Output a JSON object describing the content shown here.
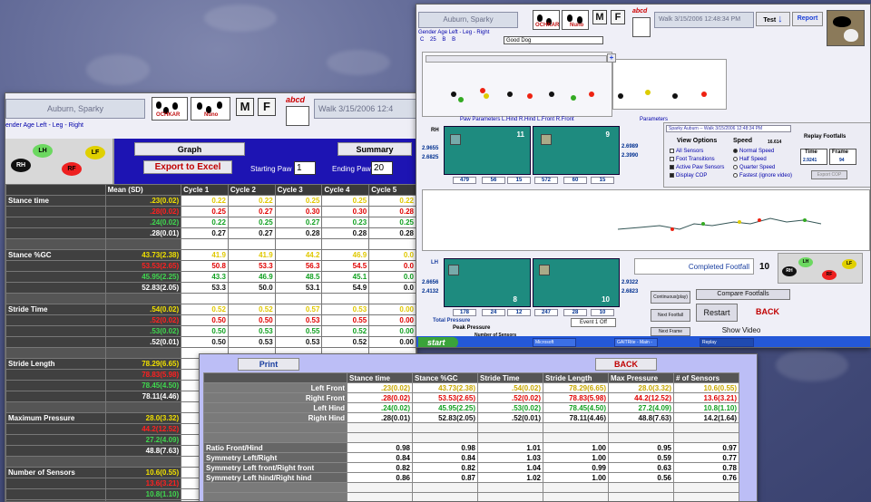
{
  "win1": {
    "dog_name": "Auburn, Sparky",
    "logo_text": "Ochkar Nuno",
    "m_label": "M",
    "f_label": "F",
    "abcd": "abcd",
    "walk": "Walk     3/15/2006 12:4",
    "gender_row": "ender  Age   Left - Leg - Right",
    "paws": {
      "lh": "LH",
      "lf": "LF",
      "rh": "RH",
      "rf": "RF"
    },
    "graph_btn": "Graph",
    "summary_btn": "Summary",
    "export_btn": "Export to Excel",
    "starting_paw_label": "Starting Paw",
    "starting_paw_value": "1",
    "ending_paw_label": "Ending Paw",
    "ending_paw_value": "20",
    "columns": [
      "Mean (SD)",
      "Cycle 1",
      "Cycle 2",
      "Cycle 3",
      "Cycle 4",
      "Cycle 5"
    ],
    "rows": [
      {
        "label": "Stance time",
        "cells": [
          ".23(0.02)",
          "0.22",
          "0.22",
          "0.25",
          "0.25",
          "0.22"
        ],
        "color": "yel"
      },
      {
        "label": "",
        "cells": [
          ".28(0.02)",
          "0.25",
          "0.27",
          "0.30",
          "0.30",
          "0.28"
        ],
        "color": "red"
      },
      {
        "label": "",
        "cells": [
          ".24(0.02)",
          "0.22",
          "0.25",
          "0.27",
          "0.23",
          "0.25"
        ],
        "color": "grn"
      },
      {
        "label": "",
        "cells": [
          ".28(0.01)",
          "0.27",
          "0.27",
          "0.28",
          "0.28",
          "0.28"
        ],
        "color": "wht"
      },
      {
        "label": "",
        "cells": [
          "",
          "",
          "",
          "",
          "",
          ""
        ],
        "color": "sep"
      },
      {
        "label": "Stance %GC",
        "cells": [
          "43.73(2.38)",
          "41.9",
          "41.9",
          "44.2",
          "46.9",
          "0.0"
        ],
        "color": "yel"
      },
      {
        "label": "",
        "cells": [
          "53.53(2.65)",
          "50.8",
          "53.3",
          "56.3",
          "54.5",
          "0.0"
        ],
        "color": "red"
      },
      {
        "label": "",
        "cells": [
          "45.95(2.25)",
          "43.3",
          "46.9",
          "48.5",
          "45.1",
          "0.0"
        ],
        "color": "grn"
      },
      {
        "label": "",
        "cells": [
          "52.83(2.05)",
          "53.3",
          "50.0",
          "53.1",
          "54.9",
          "0.0"
        ],
        "color": "wht"
      },
      {
        "label": "",
        "cells": [
          "",
          "",
          "",
          "",
          "",
          ""
        ],
        "color": "sep"
      },
      {
        "label": "Stride Time",
        "cells": [
          ".54(0.02)",
          "0.52",
          "0.52",
          "0.57",
          "0.53",
          "0.00"
        ],
        "color": "yel"
      },
      {
        "label": "",
        "cells": [
          ".52(0.02)",
          "0.50",
          "0.50",
          "0.53",
          "0.55",
          "0.00"
        ],
        "color": "red"
      },
      {
        "label": "",
        "cells": [
          ".53(0.02)",
          "0.50",
          "0.53",
          "0.55",
          "0.52",
          "0.00"
        ],
        "color": "grn"
      },
      {
        "label": "",
        "cells": [
          ".52(0.01)",
          "0.50",
          "0.53",
          "0.53",
          "0.52",
          "0.00"
        ],
        "color": "wht"
      },
      {
        "label": "",
        "cells": [
          "",
          "",
          "",
          "",
          "",
          ""
        ],
        "color": "sep"
      },
      {
        "label": "Stride Length",
        "cells": [
          "78.29(6.65)",
          "",
          "",
          "",
          "",
          ""
        ],
        "color": "yel"
      },
      {
        "label": "",
        "cells": [
          "78.83(5.98)",
          "",
          "",
          "",
          "",
          ""
        ],
        "color": "red"
      },
      {
        "label": "",
        "cells": [
          "78.45(4.50)",
          "",
          "",
          "",
          "",
          ""
        ],
        "color": "grn"
      },
      {
        "label": "",
        "cells": [
          "78.11(4.46)",
          "",
          "",
          "",
          "",
          ""
        ],
        "color": "wht"
      },
      {
        "label": "",
        "cells": [
          "",
          "",
          "",
          "",
          "",
          ""
        ],
        "color": "sep"
      },
      {
        "label": "Maximum Pressure",
        "cells": [
          "28.0(3.32)",
          "",
          "",
          "",
          "",
          ""
        ],
        "color": "yel"
      },
      {
        "label": "",
        "cells": [
          "44.2(12.52)",
          "",
          "",
          "",
          "",
          ""
        ],
        "color": "red"
      },
      {
        "label": "",
        "cells": [
          "27.2(4.09)",
          "",
          "",
          "",
          "",
          ""
        ],
        "color": "grn"
      },
      {
        "label": "",
        "cells": [
          "48.8(7.63)",
          "",
          "",
          "",
          "",
          ""
        ],
        "color": "wht"
      },
      {
        "label": "",
        "cells": [
          "",
          "",
          "",
          "",
          "",
          ""
        ],
        "color": "sep"
      },
      {
        "label": "Number of Sensors",
        "cells": [
          "10.6(0.55)",
          "",
          "",
          "",
          "",
          ""
        ],
        "color": "yel"
      },
      {
        "label": "",
        "cells": [
          "13.6(3.21)",
          "",
          "",
          "",
          "",
          ""
        ],
        "color": "red"
      },
      {
        "label": "",
        "cells": [
          "10.8(1.10)",
          "",
          "",
          "",
          "",
          ""
        ],
        "color": "grn"
      },
      {
        "label": "",
        "cells": [
          "14.2(1.64)",
          "",
          "",
          "",
          "",
          ""
        ],
        "color": "wht"
      }
    ]
  },
  "win2": {
    "dog_name": "Auburn, Sparky",
    "walk": "Walk      3/15/2006 12:48:34 PM",
    "test_btn": "Test",
    "report_btn": "Report",
    "fields_row": "Gender   Age   Left - Leg - Right",
    "fields_values": [
      "C",
      "25",
      "B",
      "B"
    ],
    "notes": "Good Dog",
    "paw_params": "Paw Parameters    L.Hind  R.Hind  L.Front  R.Front",
    "parameters": "Parameters",
    "rh": "RH",
    "rf": "RF",
    "lh": "LH",
    "lf": "LF",
    "top_left_num": "11",
    "top_right_num": "9",
    "bot_left_num": "8",
    "bot_right_num": "10",
    "rh_side": [
      "2.9655",
      "2.6825"
    ],
    "rf_side": [
      "2.6989",
      "2.3990"
    ],
    "lh_side": [
      "2.6656",
      "2.4132"
    ],
    "lf_side": [
      "2.9322",
      "2.6823"
    ],
    "top_nums": [
      "479",
      "56",
      "15",
      "572",
      "60",
      "15"
    ],
    "bot_nums": [
      "178",
      "24",
      "12",
      "247",
      "28",
      "10"
    ],
    "view_title": "Sparky Auburn -- Walk      3/15/2006 12:48:34 PM",
    "view_options": "View Options",
    "view_items": [
      {
        "label": "All Sensors",
        "on": false
      },
      {
        "label": "Foot Transitions",
        "on": false
      },
      {
        "label": "Active Paw Sensors",
        "on": true
      },
      {
        "label": "Display COP",
        "on": true
      }
    ],
    "speed": "Speed",
    "speed_val": "16.614",
    "speed_items": [
      {
        "label": "Normal Speed",
        "on": true
      },
      {
        "label": "Half Speed",
        "on": false
      },
      {
        "label": "Quarter Speed",
        "on": false
      },
      {
        "label": "Fastest (ignore video)",
        "on": false
      }
    ],
    "replay": "Replay Footfalls",
    "time_label": "Time",
    "frame_label": "Frame",
    "time_val": "2.9241",
    "frame_val": "94",
    "export_cop": "Export COP",
    "completed_footfall": "Completed Footfall",
    "completed_val": "10",
    "continuous": "Continuous(play)",
    "next_footfall": "Next Footfall",
    "next_frame": "Next Frame",
    "compare": "Compare Footfalls",
    "restart": "Restart",
    "back": "BACK",
    "show_video": "Show Video",
    "total_pressure": "Total Pressure",
    "peak_pressure": "Peak Pressure",
    "number_sensors": "Number of Sensors",
    "event": "Event 1 Off",
    "start": "start",
    "tasks": [
      "Microsoft PowerPoint",
      "GAITRite - Main - Wel",
      "Replay"
    ]
  },
  "win3": {
    "print_btn": "Print",
    "back_btn": "BACK",
    "columns": [
      "Stance time",
      "Stance %GC",
      "Stride Time",
      "Stride Length",
      "Max Pressure",
      "# of Sensors"
    ],
    "rows": [
      {
        "label": "Left Front",
        "cells": [
          ".23(0.02)",
          "43.73(2.38)",
          ".54(0.02)",
          "78.29(6.65)",
          "28.0(3.32)",
          "10.6(0.55)"
        ],
        "color": "yel"
      },
      {
        "label": "Right Front",
        "cells": [
          ".28(0.02)",
          "53.53(2.65)",
          ".52(0.02)",
          "78.83(5.98)",
          "44.2(12.52)",
          "13.6(3.21)"
        ],
        "color": "red"
      },
      {
        "label": "Left Hind",
        "cells": [
          ".24(0.02)",
          "45.95(2.25)",
          ".53(0.02)",
          "78.45(4.50)",
          "27.2(4.09)",
          "10.8(1.10)"
        ],
        "color": "grn"
      },
      {
        "label": "Right Hind",
        "cells": [
          ".28(0.01)",
          "52.83(2.05)",
          ".52(0.01)",
          "78.11(4.46)",
          "48.8(7.63)",
          "14.2(1.64)"
        ],
        "color": "blk"
      }
    ],
    "ratio_rows": [
      {
        "label": "Ratio Front/Hind",
        "cells": [
          "0.98",
          "0.98",
          "1.01",
          "1.00",
          "0.95",
          "0.97"
        ]
      },
      {
        "label": "Symmetry Left/Right",
        "cells": [
          "0.84",
          "0.84",
          "1.03",
          "1.00",
          "0.59",
          "0.77"
        ]
      },
      {
        "label": "Symmetry Left front/Right front",
        "cells": [
          "0.82",
          "0.82",
          "1.04",
          "0.99",
          "0.63",
          "0.78"
        ]
      },
      {
        "label": "Symmetry Left hind/Right hind",
        "cells": [
          "0.86",
          "0.87",
          "1.02",
          "1.00",
          "0.56",
          "0.76"
        ]
      }
    ]
  },
  "colors": {
    "blue_bar": "#1d14b3",
    "teal": "#1e8b7f",
    "summary_bg": "#bcbef6"
  }
}
